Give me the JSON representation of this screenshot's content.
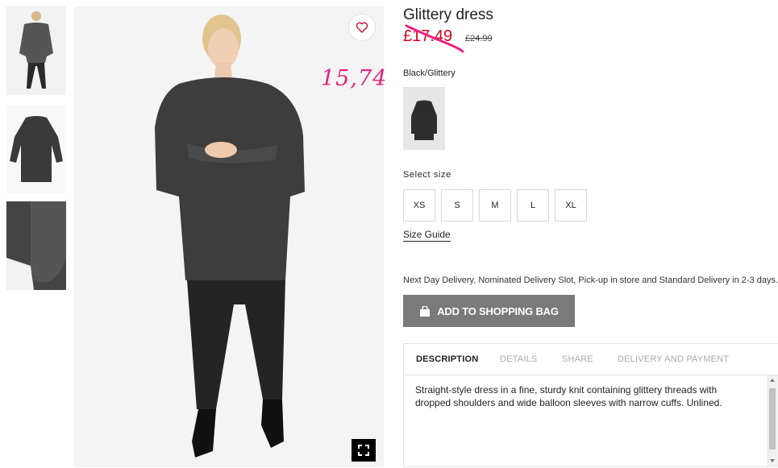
{
  "product": {
    "title": "Glittery dress",
    "sale_price": "£17.49",
    "regular_price": "£24.99",
    "handwritten_note": "15,74",
    "color_name": "Black/Glittery"
  },
  "sizes": {
    "label": "Select size",
    "options": [
      "XS",
      "S",
      "M",
      "L",
      "XL"
    ],
    "guide_label": "Size Guide"
  },
  "delivery": {
    "text": "Next Day Delivery, Nominated Delivery Slot, Pick-up in store and Standard Delivery in 2-3 days."
  },
  "cart": {
    "add_label": "ADD TO SHOPPING BAG"
  },
  "tabs": [
    {
      "label": "DESCRIPTION",
      "active": true
    },
    {
      "label": "DETAILS",
      "active": false
    },
    {
      "label": "SHARE",
      "active": false
    },
    {
      "label": "DELIVERY AND PAYMENT",
      "active": false
    }
  ],
  "description": {
    "text": "Straight-style dress in a fine, sturdy knit containing glittery threads with dropped shoulders and wide balloon sleeves with narrow cuffs. Unlined."
  },
  "icons": {
    "favorite": "heart-icon",
    "expand": "expand-icon",
    "bag": "shopping-bag-icon"
  },
  "colors": {
    "sale": "#d9001b",
    "annotation": "#e8207e",
    "button": "#7a7a7a",
    "inactive_tab": "#aaaaaa"
  }
}
